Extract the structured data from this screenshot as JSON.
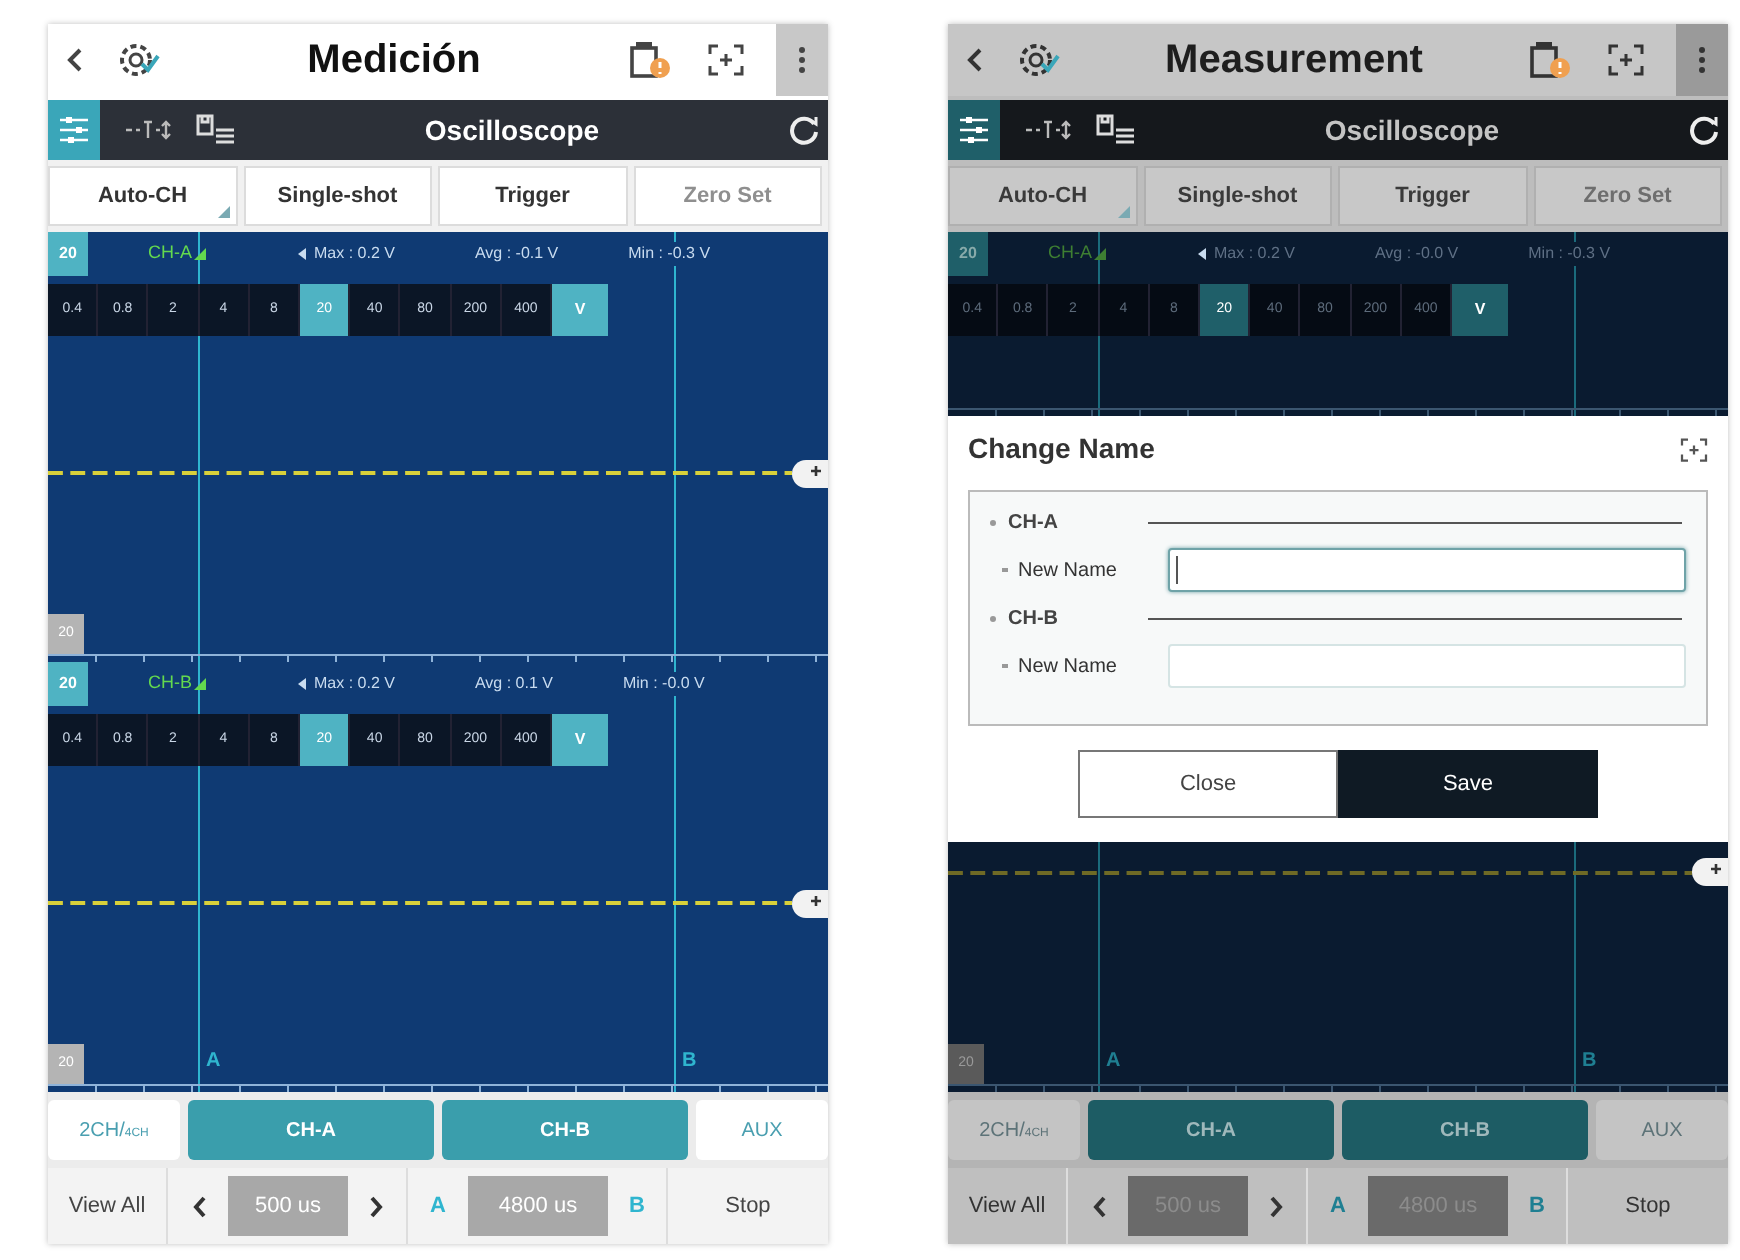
{
  "screens": [
    {
      "dimmed": false,
      "title": "Medición",
      "panel_title": "Oscilloscope",
      "actions": [
        {
          "label": "Auto-CH",
          "disabled": false,
          "corner": true
        },
        {
          "label": "Single-shot",
          "disabled": false,
          "corner": false
        },
        {
          "label": "Trigger",
          "disabled": false,
          "corner": false
        },
        {
          "label": "Zero Set",
          "disabled": true,
          "corner": false
        }
      ],
      "channels": [
        {
          "range": "20",
          "name": "CH-A",
          "max": "Max : 0.2 V",
          "avg": "Avg : -0.1 V",
          "min": "Min : -0.3 V",
          "scale": [
            {
              "label": "0.4",
              "selected": false
            },
            {
              "label": "0.8",
              "selected": false
            },
            {
              "label": "2",
              "selected": false
            },
            {
              "label": "4",
              "selected": false
            },
            {
              "label": "8",
              "selected": false
            },
            {
              "label": "20",
              "selected": true
            },
            {
              "label": "40",
              "selected": false
            },
            {
              "label": "80",
              "selected": false
            },
            {
              "label": "200",
              "selected": false
            },
            {
              "label": "400",
              "selected": false
            }
          ],
          "unit": "V",
          "trace": true,
          "bottom_range": "20"
        },
        {
          "range": "20",
          "name": "CH-B",
          "max": "Max : 0.2 V",
          "avg": "Avg : 0.1 V",
          "min": "Min : -0.0 V",
          "scale": [
            {
              "label": "0.4",
              "selected": false
            },
            {
              "label": "0.8",
              "selected": false
            },
            {
              "label": "2",
              "selected": false
            },
            {
              "label": "4",
              "selected": false
            },
            {
              "label": "8",
              "selected": false
            },
            {
              "label": "20",
              "selected": true
            },
            {
              "label": "40",
              "selected": false
            },
            {
              "label": "80",
              "selected": false
            },
            {
              "label": "200",
              "selected": false
            },
            {
              "label": "400",
              "selected": false
            }
          ],
          "unit": "V",
          "trace": true,
          "bottom_range": "20"
        }
      ],
      "cursors": [
        "A",
        "B"
      ],
      "channel_tabs": [
        {
          "label": "2CH/",
          "sub": "4CH",
          "selected": false
        },
        {
          "label": "CH-A",
          "selected": true
        },
        {
          "label": "CH-B",
          "selected": true
        },
        {
          "label": "AUX",
          "selected": false
        }
      ],
      "controls": {
        "view_all": "View All",
        "time_div": "500 us",
        "cursor_a": "A",
        "delta": "4800 us",
        "cursor_b": "B",
        "stop": "Stop"
      }
    },
    {
      "dimmed": true,
      "title": "Measurement",
      "panel_title": "Oscilloscope",
      "actions": [
        {
          "label": "Auto-CH",
          "disabled": false,
          "corner": true
        },
        {
          "label": "Single-shot",
          "disabled": false,
          "corner": false
        },
        {
          "label": "Trigger",
          "disabled": false,
          "corner": false
        },
        {
          "label": "Zero Set",
          "disabled": true,
          "corner": false
        }
      ],
      "channels": [
        {
          "range": "20",
          "name": "CH-A",
          "max": "Max : 0.2 V",
          "avg": "Avg : -0.0 V",
          "min": "Min : -0.3 V",
          "scale": [
            {
              "label": "0.4",
              "selected": false
            },
            {
              "label": "0.8",
              "selected": false
            },
            {
              "label": "2",
              "selected": false
            },
            {
              "label": "4",
              "selected": false
            },
            {
              "label": "8",
              "selected": false
            },
            {
              "label": "20",
              "selected": true
            },
            {
              "label": "40",
              "selected": false
            },
            {
              "label": "80",
              "selected": false
            },
            {
              "label": "200",
              "selected": false
            },
            {
              "label": "400",
              "selected": false
            }
          ],
          "unit": "V",
          "trace": false
        },
        {
          "trace": true,
          "bottom_range": "20"
        }
      ],
      "dialog": {
        "title": "Change Name",
        "fields": [
          {
            "channel": "CH-A",
            "label": "New Name",
            "focused": true
          },
          {
            "channel": "CH-B",
            "label": "New Name",
            "focused": false
          }
        ],
        "buttons": [
          {
            "label": "Close",
            "kind": "secondary"
          },
          {
            "label": "Save",
            "kind": "primary"
          }
        ]
      },
      "cursors": [
        "A",
        "B"
      ],
      "channel_tabs": [
        {
          "label": "2CH/",
          "sub": "4CH",
          "selected": false
        },
        {
          "label": "CH-A",
          "selected": true
        },
        {
          "label": "CH-B",
          "selected": true
        },
        {
          "label": "AUX",
          "selected": false
        }
      ],
      "controls": {
        "view_all": "View All",
        "time_div": "500 us",
        "cursor_a": "A",
        "delta": "4800 us",
        "cursor_b": "B",
        "stop": "Stop"
      }
    }
  ]
}
